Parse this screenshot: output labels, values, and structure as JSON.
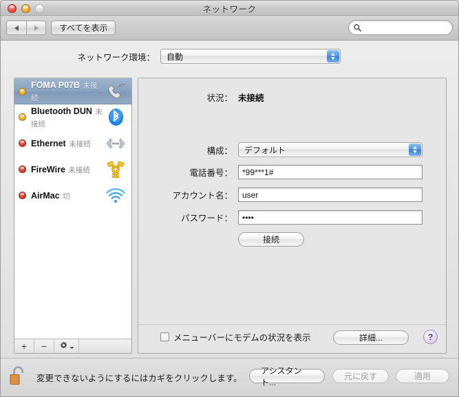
{
  "window": {
    "title": "ネットワーク",
    "traffic_lights": [
      "close",
      "minimize",
      "zoom"
    ]
  },
  "toolbar": {
    "back_icon": "triangle-left-icon",
    "forward_icon": "triangle-right-icon",
    "show_all_label": "すべてを表示",
    "search": {
      "value": "",
      "placeholder": "",
      "icon": "search-icon"
    }
  },
  "location": {
    "label": "ネットワーク環境：",
    "value": "自動"
  },
  "sidebar": {
    "services": [
      {
        "name": "FOMA P07B",
        "status": "未接続",
        "dot": "yellow",
        "icon": "modem-phone-icon",
        "selected": true
      },
      {
        "name": "Bluetooth DUN",
        "status": "未接続",
        "dot": "yellow",
        "icon": "bluetooth-icon",
        "selected": false
      },
      {
        "name": "Ethernet",
        "status": "未接続",
        "dot": "red",
        "icon": "ethernet-icon",
        "selected": false
      },
      {
        "name": "FireWire",
        "status": "未接続",
        "dot": "red",
        "icon": "firewire-icon",
        "selected": false
      },
      {
        "name": "AirMac",
        "status": "切",
        "dot": "red",
        "icon": "wifi-icon",
        "selected": false
      }
    ],
    "footer": {
      "add_label": "+",
      "remove_label": "−",
      "gear_icon": "gear-icon"
    }
  },
  "panel": {
    "status_label": "状況：",
    "status_value": "未接続",
    "config_label": "構成：",
    "config_value": "デフォルト",
    "phone_label": "電話番号：",
    "phone_value": "*99***1#",
    "account_label": "アカウント名：",
    "account_value": "user",
    "password_label": "パスワード：",
    "password_value": "••••",
    "connect_label": "接続",
    "show_modem_status_label": "メニューバーにモデムの状況を表示",
    "show_modem_status_checked": false,
    "advanced_label": "詳細...",
    "help_label": "?"
  },
  "bottom": {
    "lock_icon": "unlocked-padlock-icon",
    "lock_text": "変更できないようにするにはカギをクリックします。",
    "assistant_label": "アシスタント...",
    "revert_label": "元に戻す",
    "apply_label": "適用",
    "revert_enabled": false,
    "apply_enabled": false
  },
  "colors": {
    "selection_blue": "#8ba3c0",
    "popup_arrow_blue": "#4a92dd",
    "status_yellow": "#e8a21b",
    "status_red": "#cf2c1c",
    "help_purple": "#5b4a8c"
  }
}
